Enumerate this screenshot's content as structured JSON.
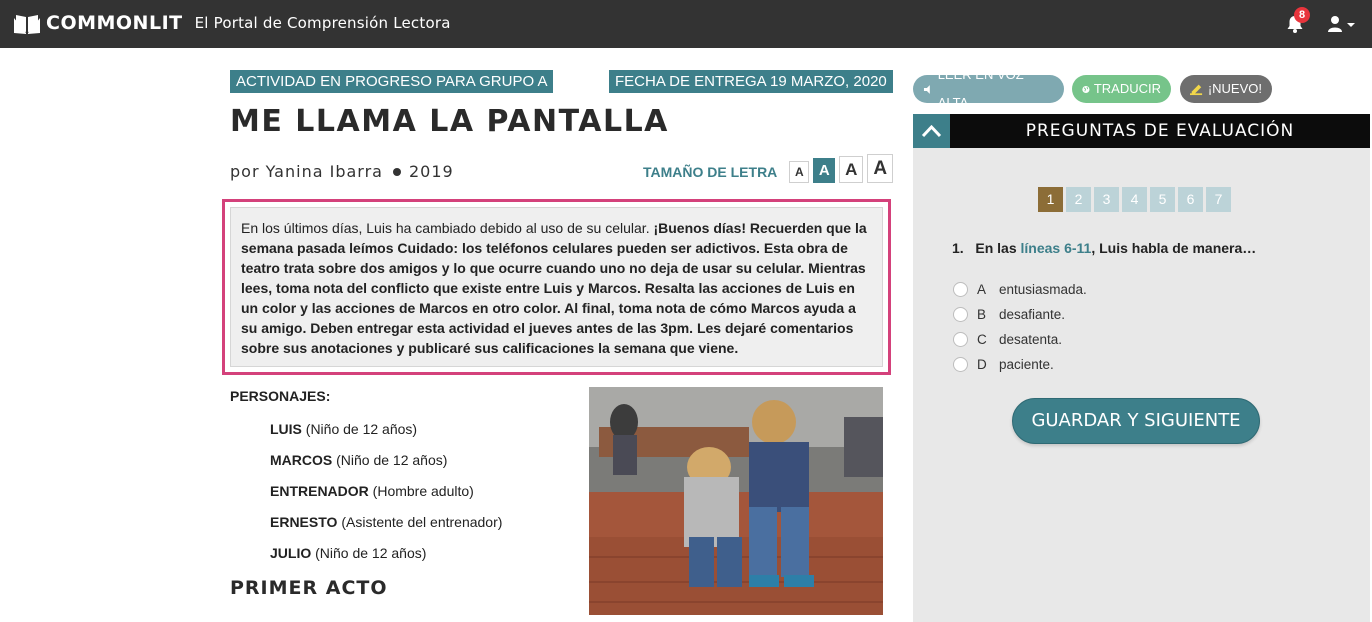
{
  "header": {
    "brand": "COMMONLIT",
    "tagline": "El Portal de Comprensión Lectora",
    "notifications_count": "8"
  },
  "text": {
    "activity_tag": "ACTIVIDAD EN PROGRESO PARA GRUPO A",
    "due_tag": "FECHA DE ENTREGA 19 MARZO, 2020",
    "title": "ME LLAMA LA PANTALLA",
    "author": "por Yanina Ibarra",
    "year": "2019",
    "font_size_label": "TAMAÑO DE LETRA",
    "font_sizes": [
      "A",
      "A",
      "A",
      "A"
    ]
  },
  "note": {
    "intro": "En los últimos días, Luis ha cambiado debido al uso de su celular. ",
    "bold": "¡Buenos días! Recuerden que la semana pasada leímos Cuidado: los teléfonos celulares pueden ser adictivos. Esta obra de teatro trata sobre dos amigos y lo que ocurre cuando uno no deja de usar su celular. Mientras lees, toma nota del conflicto que existe entre Luis y Marcos. Resalta las acciones de Luis en un color y las acciones de Marcos en otro color. Al final, toma nota de cómo Marcos ayuda a su amigo. Deben entregar esta actividad el jueves antes de las 3pm. Les dejaré comentarios sobre sus anotaciones y publicaré sus calificaciones la semana que viene."
  },
  "characters": {
    "heading": "PERSONAJES:",
    "list": [
      {
        "name": "LUIS",
        "desc": " (Niño de 12 años)"
      },
      {
        "name": "MARCOS",
        "desc": " (Niño de 12 años)"
      },
      {
        "name": "ENTRENADOR",
        "desc": " (Hombre adulto)"
      },
      {
        "name": "ERNESTO",
        "desc": " (Asistente del entrenador)"
      },
      {
        "name": "JULIO",
        "desc": " (Niño de 12 años)"
      }
    ]
  },
  "act_title": "PRIMER ACTO",
  "tools": {
    "read_aloud": "LEER EN VOZ ALTA",
    "translate": "TRADUCIR",
    "new": "¡NUEVO!"
  },
  "panel": {
    "title": "PREGUNTAS DE EVALUACIÓN",
    "question_numbers": [
      "1",
      "2",
      "3",
      "4",
      "5",
      "6",
      "7"
    ],
    "active_question": "1",
    "question_number": "1.",
    "question_pre": "En las ",
    "question_link": "líneas 6-11",
    "question_post": ", Luis habla de manera…",
    "options": [
      {
        "letter": "A",
        "text": "entusiasmada."
      },
      {
        "letter": "B",
        "text": "desafiante."
      },
      {
        "letter": "C",
        "text": "desatenta."
      },
      {
        "letter": "D",
        "text": "paciente."
      }
    ],
    "save_label": "GUARDAR Y SIGUIENTE"
  }
}
